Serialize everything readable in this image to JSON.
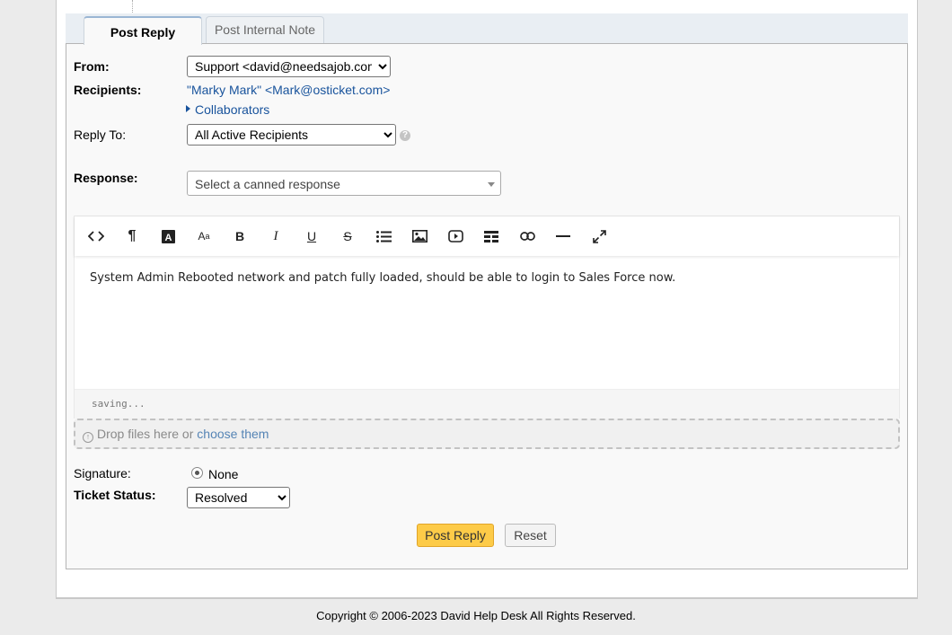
{
  "tabs": {
    "post_reply": "Post Reply",
    "internal_note": "Post Internal Note"
  },
  "form": {
    "from_label": "From:",
    "from_value": "Support <david@needsajob.com>",
    "recipients_label": "Recipients:",
    "recipients_value": "\"Marky Mark\" <Mark@osticket.com>",
    "collaborators_label": "Collaborators",
    "reply_to_label": "Reply To:",
    "reply_to_value": "All Active Recipients",
    "help_icon_glyph": "?",
    "response_label": "Response:",
    "canned_response_placeholder": "Select a canned response"
  },
  "editor": {
    "toolbar": [
      {
        "name": "html-view-icon"
      },
      {
        "name": "paragraph-format-icon"
      },
      {
        "name": "text-color-icon"
      },
      {
        "name": "font-size-icon"
      },
      {
        "name": "bold-icon"
      },
      {
        "name": "italic-icon"
      },
      {
        "name": "underline-icon"
      },
      {
        "name": "strikethrough-icon"
      },
      {
        "name": "unordered-list-icon"
      },
      {
        "name": "insert-image-icon"
      },
      {
        "name": "insert-video-icon"
      },
      {
        "name": "insert-table-icon"
      },
      {
        "name": "insert-link-icon"
      },
      {
        "name": "horizontal-rule-icon"
      },
      {
        "name": "fullscreen-icon"
      }
    ],
    "content": "System Admin Rebooted network and patch fully loaded, should be able to login to Sales Force now.",
    "status": "saving..."
  },
  "attachments": {
    "drop_text": "Drop files here or",
    "choose_link": "choose them"
  },
  "signature": {
    "label": "Signature:",
    "option": "None"
  },
  "ticket_status": {
    "label": "Ticket Status:",
    "value": "Resolved"
  },
  "buttons": {
    "post_reply": "Post Reply",
    "reset": "Reset"
  },
  "footer": "Copyright © 2006-2023 David Help Desk All Rights Reserved.",
  "colors": {
    "accent_button": "#fdcb48",
    "link": "#18539c",
    "tab_strip": "#e9eef3"
  }
}
